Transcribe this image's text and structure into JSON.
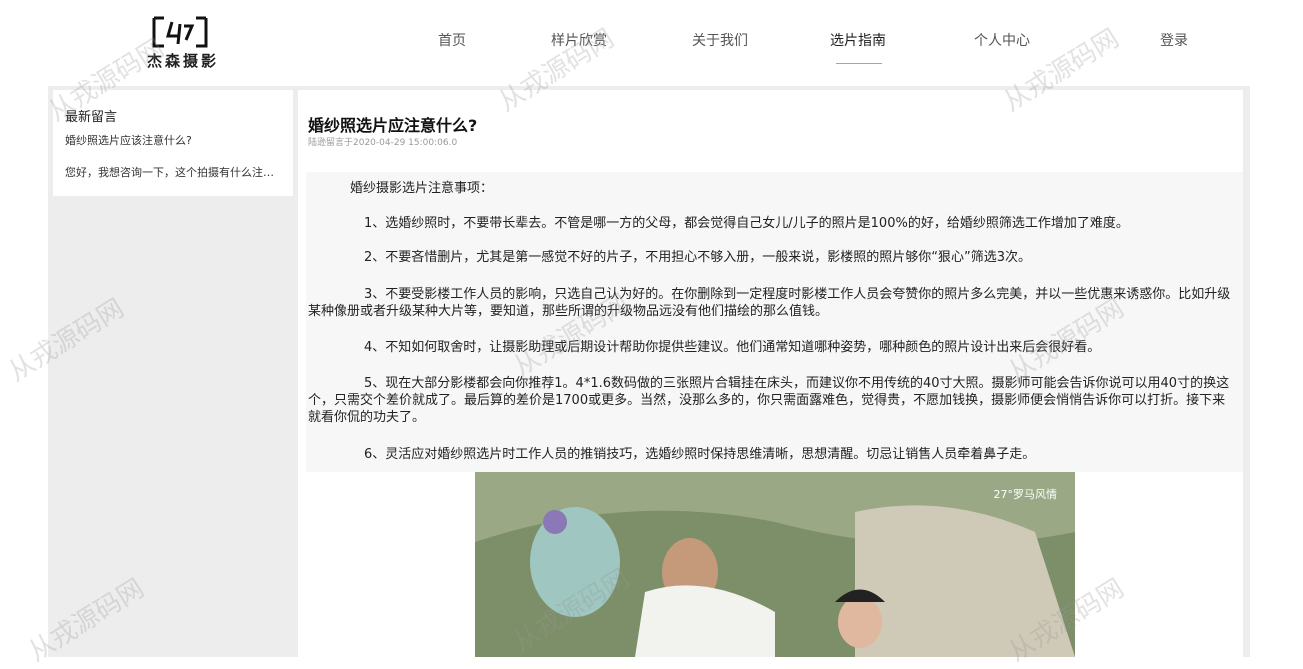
{
  "header": {
    "logo_text": "杰森摄影",
    "nav": [
      "首页",
      "样片欣赏",
      "关于我们",
      "选片指南",
      "个人中心",
      "登录"
    ],
    "active_nav": "选片指南"
  },
  "sidebar": {
    "title": "最新留言",
    "question": "婚纱照选片应该注意什么?",
    "answer": "您好，我想咨询一下，这个拍摄有什么注意事项"
  },
  "article": {
    "title": "婚纱照选片应注意什么?",
    "meta": "陆逊留言于2020-04-29 15:00:06.0",
    "intro": "婚纱摄影选片注意事项：",
    "points": [
      "1、选婚纱照时，不要带长辈去。不管是哪一方的父母，都会觉得自己女儿/儿子的照片是100%的好，给婚纱照筛选工作增加了难度。",
      "2、不要吝惜删片，尤其是第一感觉不好的片子，不用担心不够入册，一般来说，影楼照的照片够你“狠心”筛选3次。",
      "3、不要受影楼工作人员的影响，只选自己认为好的。在你删除到一定程度时影楼工作人员会夸赞你的照片多么完美，并以一些优惠来诱惑你。比如升级某种像册或者升级某种大片等，要知道，那些所谓的升级物品远没有他们描绘的那么值钱。",
      "4、不知如何取舍时，让摄影助理或后期设计帮助你提供些建议。他们通常知道哪种姿势，哪种颜色的照片设计出来后会很好看。",
      "5、现在大部分影楼都会向你推荐1。4*1.6数码做的三张照片合辑挂在床头，而建议你不用传统的40寸大照。摄影师可能会告诉你说可以用40寸的换这个，只需交个差价就成了。最后算的差价是1700或更多。当然，没那么多的，你只需面露难色，觉得贵，不愿加钱换，摄影师便会悄悄告诉你可以打折。接下来就看你侃的功夫了。",
      "6、灵活应对婚纱照选片时工作人员的推销技巧，选婚纱照时保持思维清晰，思想清醒。切忌让销售人员牵着鼻子走。"
    ],
    "photo_brand": "27°罗马风情"
  },
  "watermark": "从戎源码网",
  "colors": {
    "accent_underline": "#b8a47a",
    "band": "#ededed"
  }
}
